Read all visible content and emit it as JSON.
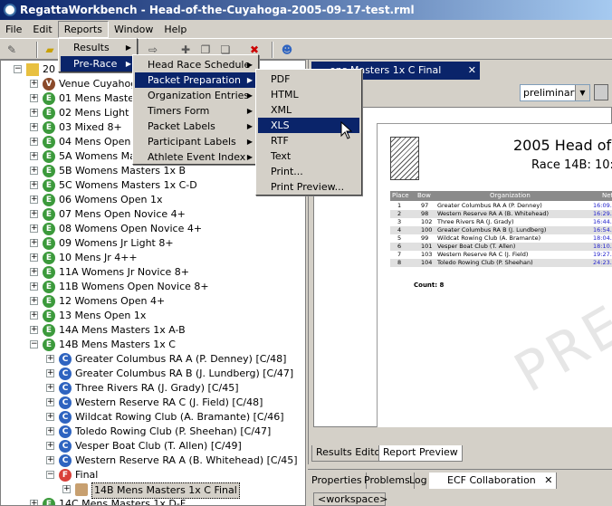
{
  "window": {
    "title": "RegattaWorkbench - Head-of-the-Cuyahoga-2005-09-17-test.rml"
  },
  "menubar": [
    "File",
    "Edit",
    "Reports",
    "Window",
    "Help"
  ],
  "reports_menu": {
    "items": [
      "Results",
      "Pre-Race"
    ]
  },
  "prerace_menu": {
    "items": [
      "Head Race Schedule",
      "Packet Preparation",
      "Organization Entries",
      "Timers Form",
      "Packet Labels",
      "Participant Labels",
      "Athlete Event Index"
    ]
  },
  "packet_menu": {
    "items": [
      "PDF",
      "HTML",
      "XML",
      "XLS",
      "RTF",
      "Text",
      "Print...",
      "Print Preview..."
    ]
  },
  "tree": {
    "rows": [
      {
        "icon": "",
        "label": "20",
        "indent": 0,
        "toggle": "-"
      },
      {
        "icon": "V",
        "label": "Venue Cuyahog",
        "indent": 1,
        "toggle": "+"
      },
      {
        "icon": "E",
        "label": "01  Mens Maste",
        "indent": 1,
        "toggle": "+"
      },
      {
        "icon": "E",
        "label": "02  Mens Light 8",
        "indent": 1,
        "toggle": "+"
      },
      {
        "icon": "E",
        "label": "03  Mixed 8+",
        "indent": 1,
        "toggle": "+"
      },
      {
        "icon": "E",
        "label": "04  Mens Open",
        "indent": 1,
        "toggle": "+"
      },
      {
        "icon": "E",
        "label": "5A  Womens Ma",
        "indent": 1,
        "toggle": "+"
      },
      {
        "icon": "E",
        "label": "5B  Womens Masters 1x B",
        "indent": 1,
        "toggle": "+"
      },
      {
        "icon": "E",
        "label": "5C  Womens Masters 1x C-D",
        "indent": 1,
        "toggle": "+"
      },
      {
        "icon": "E",
        "label": "06  Womens Open 1x",
        "indent": 1,
        "toggle": "+"
      },
      {
        "icon": "E",
        "label": "07  Mens Open Novice 4+",
        "indent": 1,
        "toggle": "+"
      },
      {
        "icon": "E",
        "label": "08  Womens Open Novice 4+",
        "indent": 1,
        "toggle": "+"
      },
      {
        "icon": "E",
        "label": "09  Womens Jr Light 8+",
        "indent": 1,
        "toggle": "+"
      },
      {
        "icon": "E",
        "label": "10  Mens Jr 4++",
        "indent": 1,
        "toggle": "+"
      },
      {
        "icon": "E",
        "label": "11A  Womens Jr Novice 8+",
        "indent": 1,
        "toggle": "+"
      },
      {
        "icon": "E",
        "label": "11B  Womens Open Novice 8+",
        "indent": 1,
        "toggle": "+"
      },
      {
        "icon": "E",
        "label": "12  Womens Open 4+",
        "indent": 1,
        "toggle": "+"
      },
      {
        "icon": "E",
        "label": "13  Mens Open 1x",
        "indent": 1,
        "toggle": "+"
      },
      {
        "icon": "E",
        "label": "14A  Mens Masters 1x A-B",
        "indent": 1,
        "toggle": "+"
      },
      {
        "icon": "E",
        "label": "14B  Mens Masters 1x C",
        "indent": 1,
        "toggle": "-"
      },
      {
        "icon": "C",
        "label": "Greater Columbus RA A  (P. Denney) [C/48]",
        "indent": 2,
        "toggle": "+"
      },
      {
        "icon": "C",
        "label": "Greater Columbus RA B  (J. Lundberg) [C/47]",
        "indent": 2,
        "toggle": "+"
      },
      {
        "icon": "C",
        "label": "Three Rivers RA  (J. Grady) [C/45]",
        "indent": 2,
        "toggle": "+"
      },
      {
        "icon": "C",
        "label": "Western Reserve RA C  (J. Field) [C/48]",
        "indent": 2,
        "toggle": "+"
      },
      {
        "icon": "C",
        "label": "Wildcat Rowing Club  (A. Bramante) [C/46]",
        "indent": 2,
        "toggle": "+"
      },
      {
        "icon": "C",
        "label": "Toledo Rowing Club  (P. Sheehan) [C/47]",
        "indent": 2,
        "toggle": "+"
      },
      {
        "icon": "C",
        "label": "Vesper Boat Club  (T. Allen) [C/49]",
        "indent": 2,
        "toggle": "+"
      },
      {
        "icon": "C",
        "label": "Western Reserve RA A  (B. Whitehead) [C/45]",
        "indent": 2,
        "toggle": "+"
      },
      {
        "icon": "F",
        "label": "Final",
        "indent": 2,
        "toggle": "-"
      },
      {
        "icon": "R",
        "label": "14B  Mens Masters 1x C Final",
        "indent": 3,
        "toggle": "+",
        "selected": true
      },
      {
        "icon": "E",
        "label": "14C  Mens Masters 1x D-F",
        "indent": 1,
        "toggle": "+"
      }
    ]
  },
  "editor": {
    "tab_label": "ens Masters 1x C Final",
    "status_select": "preliminary"
  },
  "report": {
    "title": "2005 Head of",
    "subtitle": "Race 14B:  10:",
    "headers": [
      "Place",
      "Bow",
      "Organization",
      "Net Ti"
    ],
    "rows": [
      {
        "place": "1",
        "bow": "97",
        "org": "Greater Columbus RA A (P. Denney)",
        "time": "16:09."
      },
      {
        "place": "2",
        "bow": "98",
        "org": "Western Reserve RA A  (B. Whitehead)",
        "time": "16:29."
      },
      {
        "place": "3",
        "bow": "102",
        "org": "Three Rivers RA  (J. Grady)",
        "time": "16:44."
      },
      {
        "place": "4",
        "bow": "100",
        "org": "Greater Columbus RA B (J. Lundberg)",
        "time": "16:54."
      },
      {
        "place": "5",
        "bow": "99",
        "org": "Wildcat Rowing Club  (A. Bramante)",
        "time": "18:04."
      },
      {
        "place": "6",
        "bow": "101",
        "org": "Vesper Boat Club  (T. Allen)",
        "time": "18:10."
      },
      {
        "place": "7",
        "bow": "103",
        "org": "Western Reserve RA C  (J. Field)",
        "time": "19:27."
      },
      {
        "place": "8",
        "bow": "104",
        "org": "Toledo Rowing Club  (P. Sheehan)",
        "time": "24:23."
      }
    ],
    "count": "Count: 8",
    "watermark": "PRELI"
  },
  "editor_tabs": [
    "Results Editor",
    "Report Preview"
  ],
  "views": [
    "Properties",
    "Problems",
    "Log",
    "ECF Collaboration"
  ],
  "workspace_label": "<workspace>",
  "colors": {
    "title_bar": "#0a246a",
    "menu_highlight": "#0a246a",
    "event_icon": "#3c9a3c",
    "crew_icon": "#2f64c0"
  }
}
